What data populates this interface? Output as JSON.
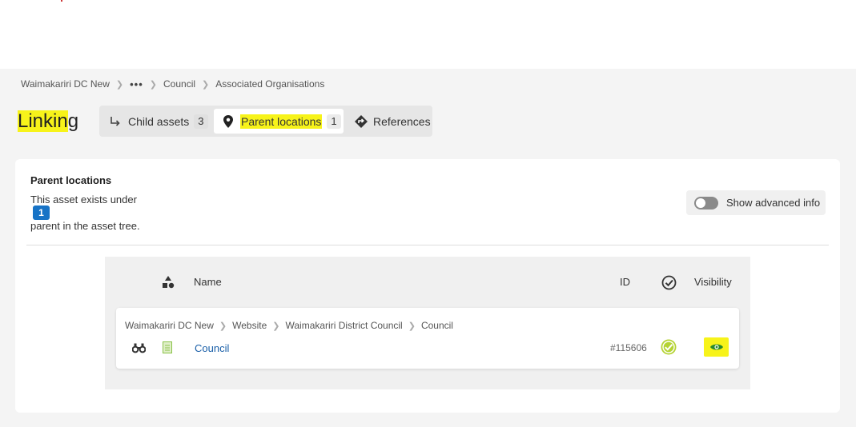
{
  "breadcrumb": {
    "items": [
      "Waimakariri DC New",
      "•••",
      "Council",
      "Associated Organisations"
    ]
  },
  "page": {
    "title_part1": "Linkin",
    "title_part2": "g"
  },
  "tabs": [
    {
      "label": "Child assets",
      "count": "3",
      "icon": "child-arrow-icon"
    },
    {
      "label": "Parent locations",
      "count": "1",
      "icon": "map-pin-icon",
      "active": true
    },
    {
      "label": "References",
      "icon": "diamond-arrow-icon"
    }
  ],
  "card": {
    "title": "Parent locations",
    "desc_before": "This asset exists under",
    "count": "1",
    "desc_after": "parent in the asset tree.",
    "advanced_toggle_label": "Show advanced info",
    "advanced_toggle_on": false
  },
  "table": {
    "headers": {
      "type": "shapes-icon",
      "name": "Name",
      "id": "ID",
      "status": "check-badge-icon",
      "visibility": "Visibility"
    },
    "rows": [
      {
        "path": [
          "Waimakariri DC New",
          "Website",
          "Waimakariri District Council",
          "Council"
        ],
        "name": "Council",
        "id": "#115606",
        "visible": true
      }
    ]
  },
  "colors": {
    "highlight": "#f7f31a",
    "link": "#1a5fa8",
    "badge_blue": "#1773c6",
    "status_green": "#b5d334",
    "doc_green": "#8bc34a"
  }
}
